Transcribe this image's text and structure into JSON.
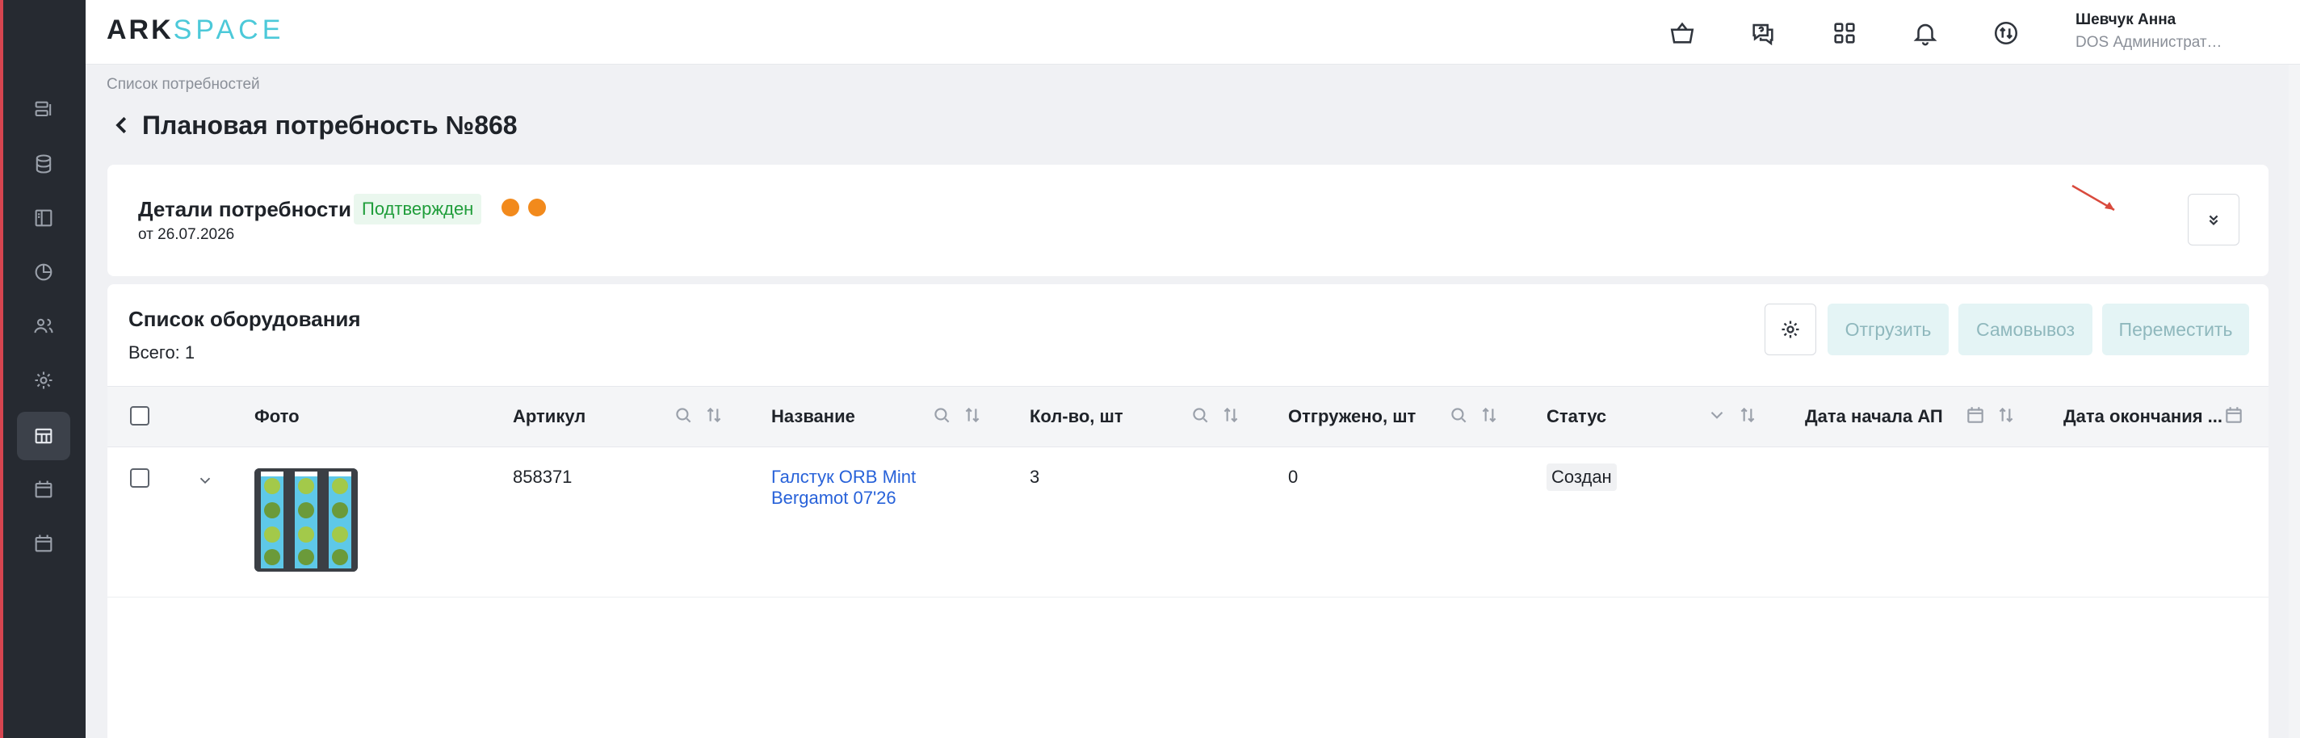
{
  "app": {
    "logo_left": "ARK",
    "logo_right": "SPACE"
  },
  "user": {
    "name": "Шевчук Анна",
    "role": "DOS Администратор системы"
  },
  "breadcrumb": "Список потребностей",
  "page_title": "Плановая потребность №868",
  "details": {
    "title": "Детали потребности",
    "date": "от 26.07.2026",
    "status": "Подтвержден",
    "status_color": "#1f9d3a",
    "dot_color": "#f28a1c"
  },
  "equipment": {
    "title": "Список оборудования",
    "total": "Всего: 1",
    "buttons": {
      "ship": "Отгрузить",
      "pickup": "Самовывоз",
      "move": "Переместить"
    },
    "columns": {
      "photo": "Фото",
      "article": "Артикул",
      "name": "Название",
      "qty": "Кол-во, шт",
      "shipped": "Отгружено, шт",
      "status": "Статус",
      "start": "Дата начала АП",
      "end": "Дата окончания ..."
    },
    "rows": [
      {
        "article": "858371",
        "name": "Галстук ORB Mint Bergamot 07'26",
        "qty": "3",
        "shipped": "0",
        "status": "Создан"
      }
    ]
  },
  "colors": {
    "sidebar": "#262a31",
    "accent": "#4cc9d9",
    "link": "#2862d9"
  }
}
